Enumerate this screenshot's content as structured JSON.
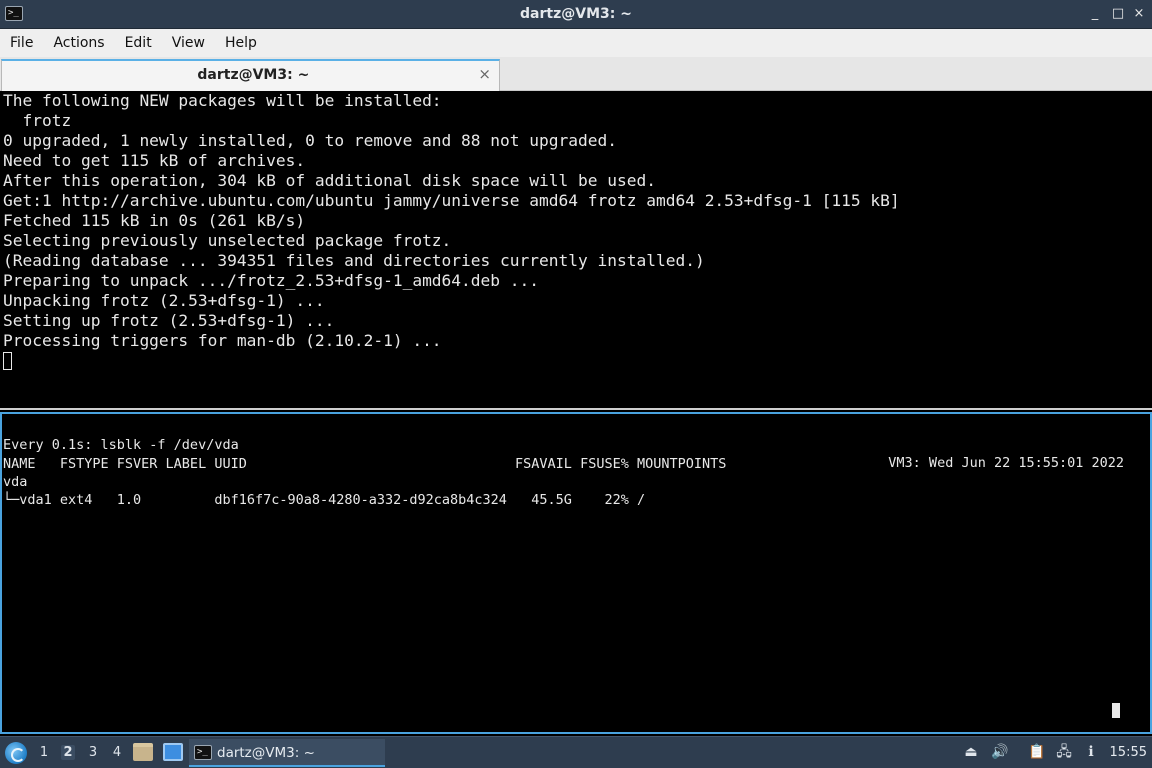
{
  "window": {
    "title": "dartz@VM3: ~",
    "controls": [
      "_",
      "□",
      "×"
    ]
  },
  "menu": [
    "File",
    "Actions",
    "Edit",
    "View",
    "Help"
  ],
  "tab": {
    "label": "dartz@VM3: ~",
    "close": "×"
  },
  "top_pane": {
    "lines": [
      "The following NEW packages will be installed:",
      "  frotz",
      "0 upgraded, 1 newly installed, 0 to remove and 88 not upgraded.",
      "Need to get 115 kB of archives.",
      "After this operation, 304 kB of additional disk space will be used.",
      "Get:1 http://archive.ubuntu.com/ubuntu jammy/universe amd64 frotz amd64 2.53+dfsg-1 [115 kB]",
      "Fetched 115 kB in 0s (261 kB/s)",
      "Selecting previously unselected package frotz.",
      "(Reading database ... 394351 files and directories currently installed.)",
      "Preparing to unpack .../frotz_2.53+dfsg-1_amd64.deb ...",
      "Unpacking frotz (2.53+dfsg-1) ...",
      "Setting up frotz (2.53+dfsg-1) ...",
      "Processing triggers for man-db (2.10.2-1) ..."
    ]
  },
  "bottom_pane": {
    "header_left": "Every 0.1s: lsblk -f /dev/vda",
    "header_right": "VM3: Wed Jun 22 15:55:01 2022",
    "lines": [
      "NAME   FSTYPE FSVER LABEL UUID                                 FSAVAIL FSUSE% MOUNTPOINTS",
      "vda",
      "└─vda1 ext4   1.0         dbf16f7c-90a8-4280-a332-d92ca8b4c324   45.5G    22% /"
    ]
  },
  "taskbar": {
    "desktops": [
      "1",
      "2",
      "3",
      "4"
    ],
    "active_desktop": "2",
    "task_label": "dartz@VM3: ~",
    "clock": "15:55",
    "tray_icons": [
      "eject-icon",
      "volume-icon",
      "clipboard-icon",
      "network-icon",
      "notification-icon"
    ]
  }
}
